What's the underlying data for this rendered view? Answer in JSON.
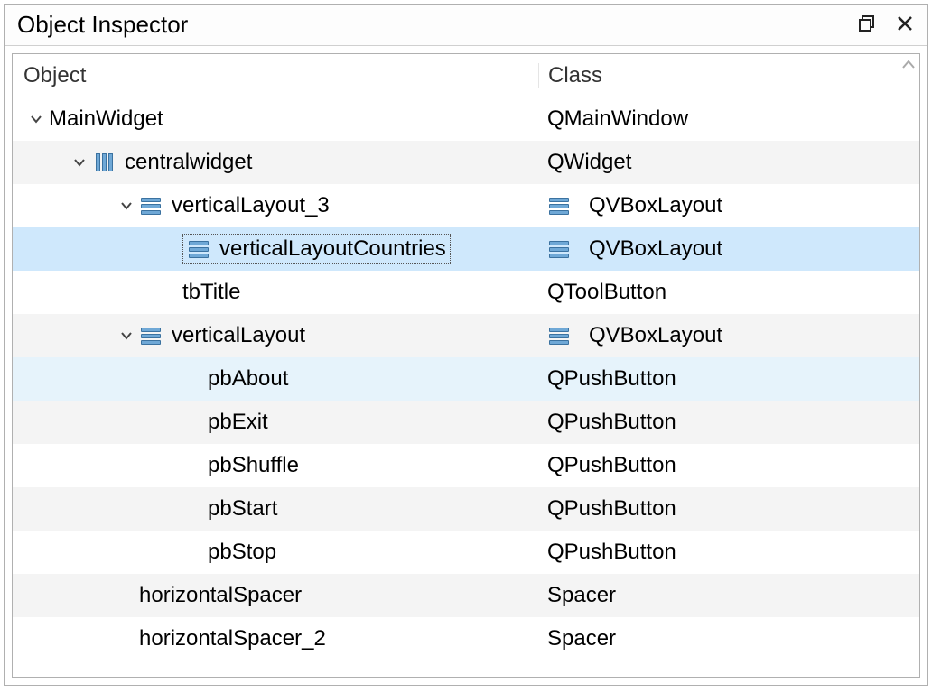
{
  "titlebar": {
    "title": "Object Inspector"
  },
  "headers": {
    "object": "Object",
    "class": "Class"
  },
  "rows": [
    {
      "object": "MainWidget",
      "class": "QMainWindow"
    },
    {
      "object": "centralwidget",
      "class": "QWidget"
    },
    {
      "object": "verticalLayout_3",
      "class": "QVBoxLayout"
    },
    {
      "object": "verticalLayoutCountries",
      "class": "QVBoxLayout"
    },
    {
      "object": "tbTitle",
      "class": "QToolButton"
    },
    {
      "object": "verticalLayout",
      "class": "QVBoxLayout"
    },
    {
      "object": "pbAbout",
      "class": "QPushButton"
    },
    {
      "object": "pbExit",
      "class": "QPushButton"
    },
    {
      "object": "pbShuffle",
      "class": "QPushButton"
    },
    {
      "object": "pbStart",
      "class": "QPushButton"
    },
    {
      "object": "pbStop",
      "class": "QPushButton"
    },
    {
      "object": "horizontalSpacer",
      "class": "Spacer"
    },
    {
      "object": "horizontalSpacer_2",
      "class": "Spacer"
    }
  ]
}
